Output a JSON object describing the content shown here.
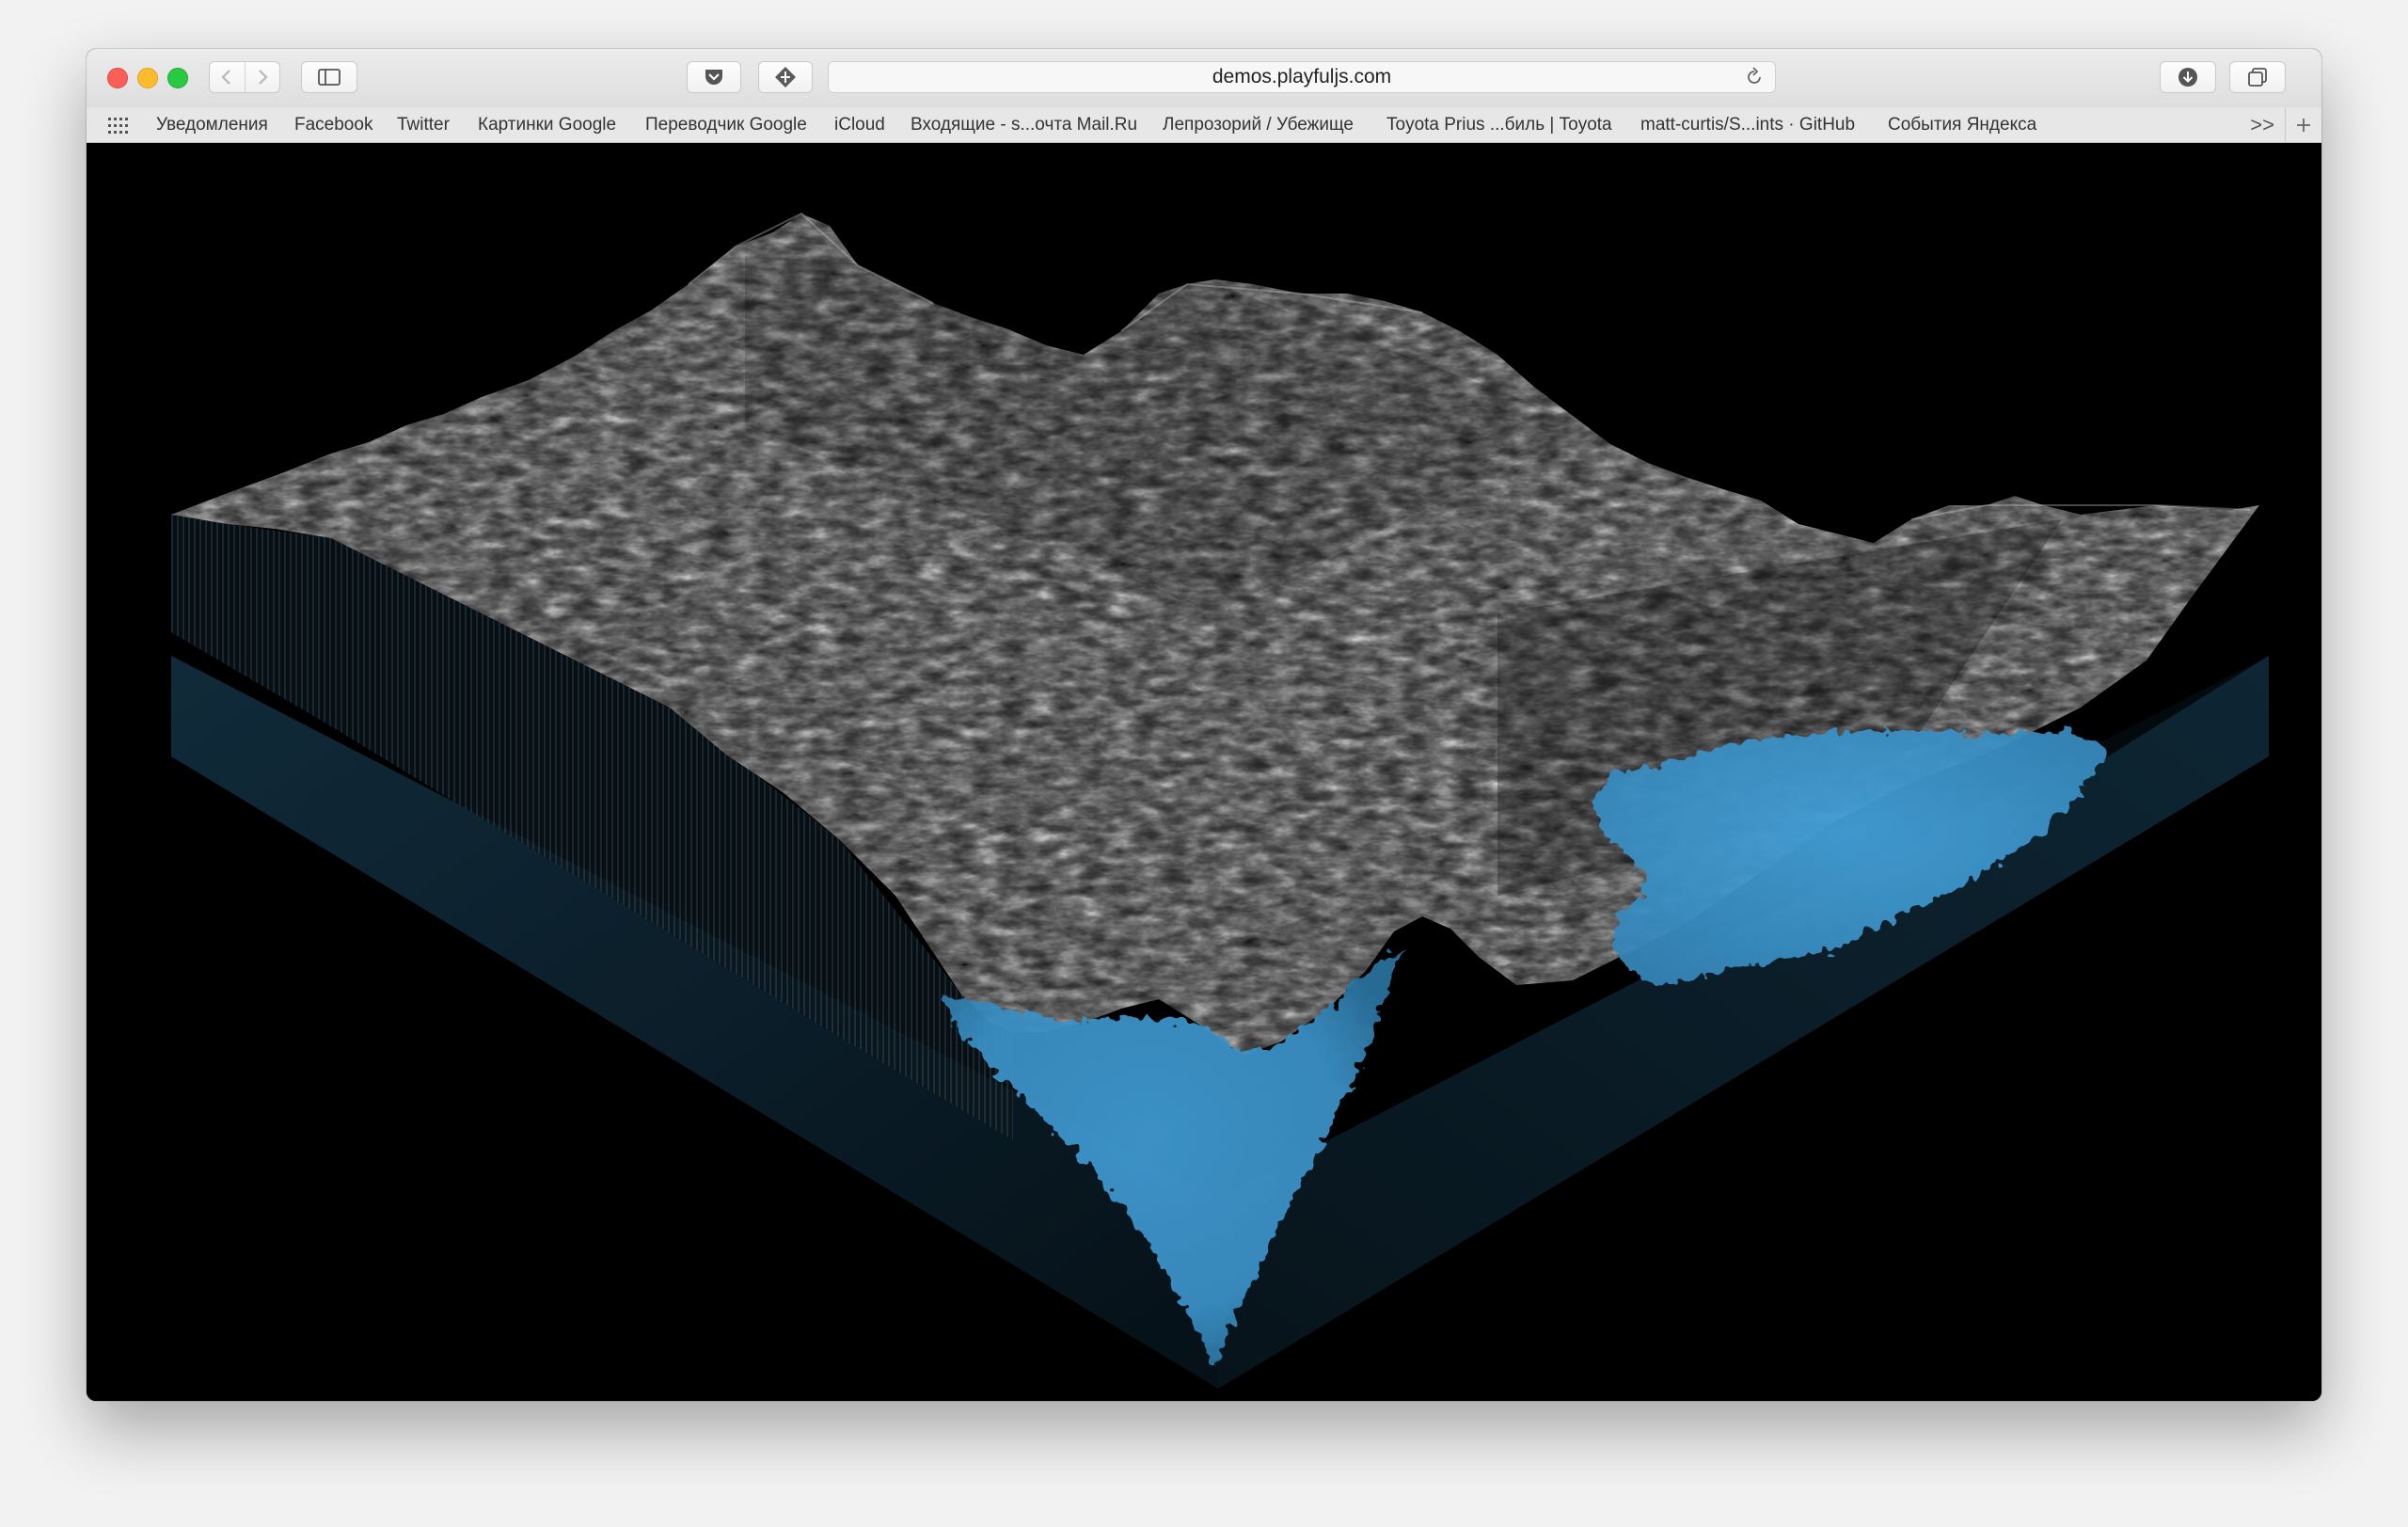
{
  "browser": {
    "url": "demos.playfuljs.com",
    "buttons": {
      "back": "chevron-left-icon",
      "forward": "chevron-right-icon",
      "sidebar": "sidebar-icon",
      "pocket": "pocket-icon",
      "extension": "extension-diamond-icon",
      "reload": "reload-icon",
      "download": "download-icon",
      "tabs": "tabs-overview-icon"
    }
  },
  "bookmarks": {
    "items": [
      "Уведомления",
      "Facebook",
      "Twitter",
      "Картинки Google",
      "Переводчик Google",
      "iCloud",
      "Входящие - s...очта Mail.Ru",
      "Лепрозорий / Убежище",
      "Toyota Prius ...биль | Toyota",
      "matt-curtis/S...ints · GitHub",
      "События Яндекса"
    ],
    "more": ">>"
  },
  "scene": {
    "description_colors": {
      "background": "#000000",
      "water": "#3d96cc",
      "water_dark": "#0b1a24",
      "rock_light": "#e6e6e6",
      "rock_dark": "#1a1a1a"
    }
  }
}
